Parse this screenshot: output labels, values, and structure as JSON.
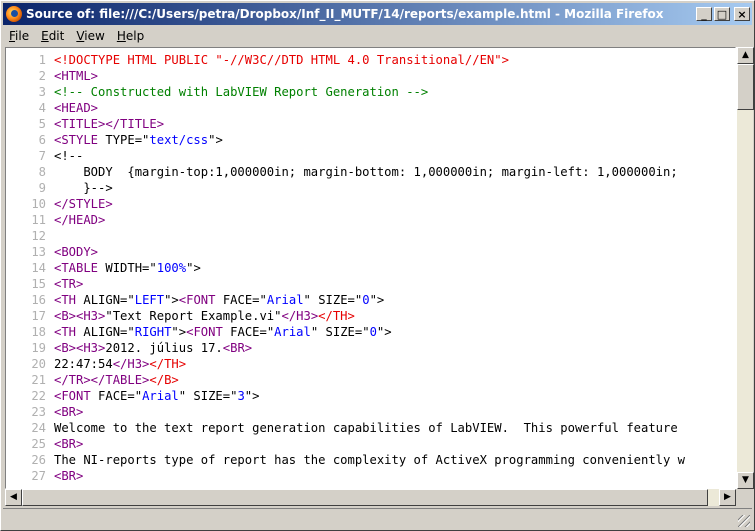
{
  "window": {
    "title": "Source of: file:///C:/Users/petra/Dropbox/Inf_II_MUTF/14/reports/example.html - Mozilla Firefox",
    "minimize": "_",
    "maximize": "□",
    "close": "×"
  },
  "menu": [
    {
      "label": "File",
      "u": "F",
      "rest": "ile"
    },
    {
      "label": "Edit",
      "u": "E",
      "rest": "dit"
    },
    {
      "label": "View",
      "u": "V",
      "rest": "iew"
    },
    {
      "label": "Help",
      "u": "H",
      "rest": "elp"
    }
  ],
  "source_lines": [
    {
      "n": "1",
      "parts": [
        [
          "red",
          "<!DOCTYPE HTML PUBLIC \"-//W3C//DTD HTML 4.0 Transitional//EN\">"
        ]
      ]
    },
    {
      "n": "2",
      "parts": [
        [
          "purple",
          "<HTML>"
        ]
      ]
    },
    {
      "n": "3",
      "parts": [
        [
          "green",
          "<!-- Constructed with LabVIEW Report Generation -->"
        ]
      ]
    },
    {
      "n": "4",
      "parts": [
        [
          "purple",
          "<HEAD>"
        ]
      ]
    },
    {
      "n": "5",
      "parts": [
        [
          "purple",
          "<TITLE></TITLE>"
        ]
      ]
    },
    {
      "n": "6",
      "parts": [
        [
          "purple",
          "<STYLE "
        ],
        [
          "black",
          "TYPE=\""
        ],
        [
          "blue",
          "text/css"
        ],
        [
          "black",
          "\">"
        ]
      ]
    },
    {
      "n": "7",
      "parts": [
        [
          "black",
          "<!--"
        ]
      ]
    },
    {
      "n": "8",
      "parts": [
        [
          "black",
          "    BODY  {margin-top:1,000000in; margin-bottom: 1,000000in; margin-left: 1,000000in;"
        ]
      ]
    },
    {
      "n": "9",
      "parts": [
        [
          "black",
          "    }-->"
        ]
      ]
    },
    {
      "n": "10",
      "parts": [
        [
          "purple",
          "</STYLE>"
        ]
      ]
    },
    {
      "n": "11",
      "parts": [
        [
          "purple",
          "</HEAD>"
        ]
      ]
    },
    {
      "n": "12",
      "parts": [
        [
          "black",
          ""
        ]
      ]
    },
    {
      "n": "13",
      "parts": [
        [
          "purple",
          "<BODY>"
        ]
      ]
    },
    {
      "n": "14",
      "parts": [
        [
          "purple",
          "<TABLE "
        ],
        [
          "black",
          "WIDTH=\""
        ],
        [
          "blue",
          "100%"
        ],
        [
          "black",
          "\">"
        ]
      ]
    },
    {
      "n": "15",
      "parts": [
        [
          "purple",
          "<TR>"
        ]
      ]
    },
    {
      "n": "16",
      "parts": [
        [
          "purple",
          "<TH "
        ],
        [
          "black",
          "ALIGN=\""
        ],
        [
          "blue",
          "LEFT"
        ],
        [
          "black",
          "\">"
        ],
        [
          "purple",
          "<FONT "
        ],
        [
          "black",
          "FACE=\""
        ],
        [
          "blue",
          "Arial"
        ],
        [
          "black",
          "\" SIZE=\""
        ],
        [
          "blue",
          "0"
        ],
        [
          "black",
          "\">"
        ]
      ]
    },
    {
      "n": "17",
      "parts": [
        [
          "purple",
          "<B><H3>"
        ],
        [
          "black",
          "\"Text Report Example.vi\""
        ],
        [
          "purple",
          "</H3>"
        ],
        [
          "red",
          "</TH>"
        ]
      ]
    },
    {
      "n": "18",
      "parts": [
        [
          "purple",
          "<TH "
        ],
        [
          "black",
          "ALIGN=\""
        ],
        [
          "blue",
          "RIGHT"
        ],
        [
          "black",
          "\">"
        ],
        [
          "purple",
          "<FONT "
        ],
        [
          "black",
          "FACE=\""
        ],
        [
          "blue",
          "Arial"
        ],
        [
          "black",
          "\" SIZE=\""
        ],
        [
          "blue",
          "0"
        ],
        [
          "black",
          "\">"
        ]
      ]
    },
    {
      "n": "19",
      "parts": [
        [
          "purple",
          "<B><H3>"
        ],
        [
          "black",
          "2012. július 17."
        ],
        [
          "purple",
          "<BR>"
        ]
      ]
    },
    {
      "n": "20",
      "parts": [
        [
          "black",
          "22:47:54"
        ],
        [
          "purple",
          "</H3>"
        ],
        [
          "red",
          "</TH>"
        ]
      ]
    },
    {
      "n": "21",
      "parts": [
        [
          "purple",
          "</TR></TABLE>"
        ],
        [
          "red",
          "</B>"
        ]
      ]
    },
    {
      "n": "22",
      "parts": [
        [
          "purple",
          "<FONT "
        ],
        [
          "black",
          "FACE=\""
        ],
        [
          "blue",
          "Arial"
        ],
        [
          "black",
          "\" SIZE=\""
        ],
        [
          "blue",
          "3"
        ],
        [
          "black",
          "\">"
        ]
      ]
    },
    {
      "n": "23",
      "parts": [
        [
          "purple",
          "<BR>"
        ]
      ]
    },
    {
      "n": "24",
      "parts": [
        [
          "black",
          "Welcome to the text report generation capabilities of LabVIEW.  This powerful feature"
        ]
      ]
    },
    {
      "n": "25",
      "parts": [
        [
          "purple",
          "<BR>"
        ]
      ]
    },
    {
      "n": "26",
      "parts": [
        [
          "black",
          "The NI-reports type of report has the complexity of ActiveX programming conveniently w"
        ]
      ]
    },
    {
      "n": "27",
      "parts": [
        [
          "purple",
          "<BR>"
        ]
      ]
    }
  ],
  "scroll": {
    "up": "▲",
    "down": "▼",
    "left": "◀",
    "right": "▶"
  }
}
